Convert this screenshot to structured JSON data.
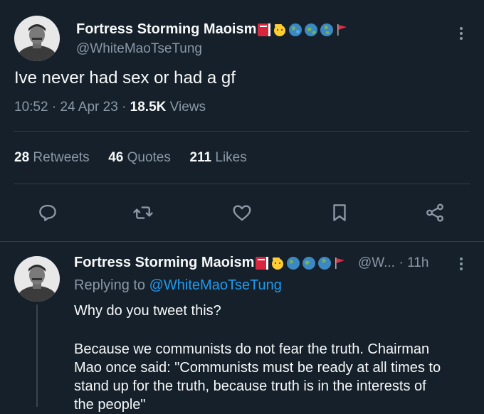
{
  "tweet": {
    "display_name": "Fortress Storming Maoism",
    "handle": "@WhiteMaoTseTung",
    "text": "Ive never had sex or had a gf",
    "time": "10:52",
    "date": "24 Apr 23",
    "views_count": "18.5K",
    "views_label": "Views",
    "separator": "·",
    "stats": {
      "retweets_count": "28",
      "retweets_label": "Retweets",
      "quotes_count": "46",
      "quotes_label": "Quotes",
      "likes_count": "211",
      "likes_label": "Likes"
    },
    "actions": [
      "reply-icon",
      "retweet-icon",
      "like-icon",
      "bookmark-icon",
      "share-icon"
    ]
  },
  "reply": {
    "display_name": "Fortress Storming Maoism",
    "handle_truncated": "@W...",
    "age": "· 11h",
    "replying_prefix": "Replying to",
    "replying_handle": "@WhiteMaoTseTung",
    "line1": "Why do you tweet this?",
    "line2": "Because we communists do not fear the truth. Chairman",
    "line3": "Mao once said: \"Communists must be ready at all times to",
    "line4": "stand up for the truth, because truth is in the interests of",
    "line5": "the people\""
  },
  "colors": {
    "background": "#15202b",
    "text": "#f7f9f9",
    "muted": "#8b98a5",
    "link": "#1d9bf0",
    "divider": "#2f3b47"
  },
  "name_badges": [
    "red-book-emoji",
    "salute-face-emoji",
    "globe-emoji",
    "globe-emoji",
    "globe-emoji",
    "red-flag-emoji"
  ]
}
